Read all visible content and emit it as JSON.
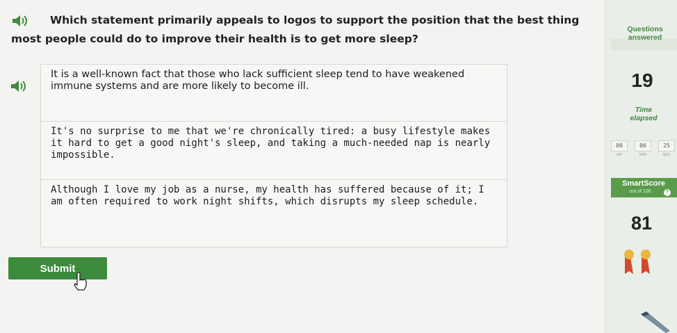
{
  "question": {
    "prefix": "Which statement primarily appeals to ",
    "keyword": "logos",
    "suffix": " to support the position that the best thing most people could do to improve their health is to get more sleep?"
  },
  "choices": [
    {
      "text": "It is a well-known fact that those who lack sufficient sleep tend to have weakened immune systems and are more likely to become ill."
    },
    {
      "text": "It's no surprise to me that we're chronically tired: a busy lifestyle makes it hard to get a good night's sleep, and taking a much-needed nap is nearly impossible."
    },
    {
      "text": "Although I love my job as a nurse, my health has suffered because of it; I am often required to work night shifts, which disrupts my sleep schedule."
    }
  ],
  "submit_label": "Submit",
  "sidebar": {
    "questions_label_line1": "Questions",
    "questions_label_line2": "answered",
    "questions_count": "19",
    "time_label_line1": "Time",
    "time_label_line2": "elapsed",
    "timer": {
      "hours": "00",
      "minutes": "06",
      "seconds": "25",
      "hours_label": "HR",
      "minutes_label": "MIN",
      "seconds_label": "SEC"
    },
    "smartscore_label": "SmartScore",
    "smartscore_sub": "out of 100",
    "smartscore_info": "?",
    "score": "81"
  },
  "colors": {
    "accent_green": "#3f8a3c",
    "submit_green": "#3c8a3c",
    "smartscore_band": "#5a9c4a",
    "medal_red": "#d24a2c",
    "medal_gold": "#e8b640"
  }
}
